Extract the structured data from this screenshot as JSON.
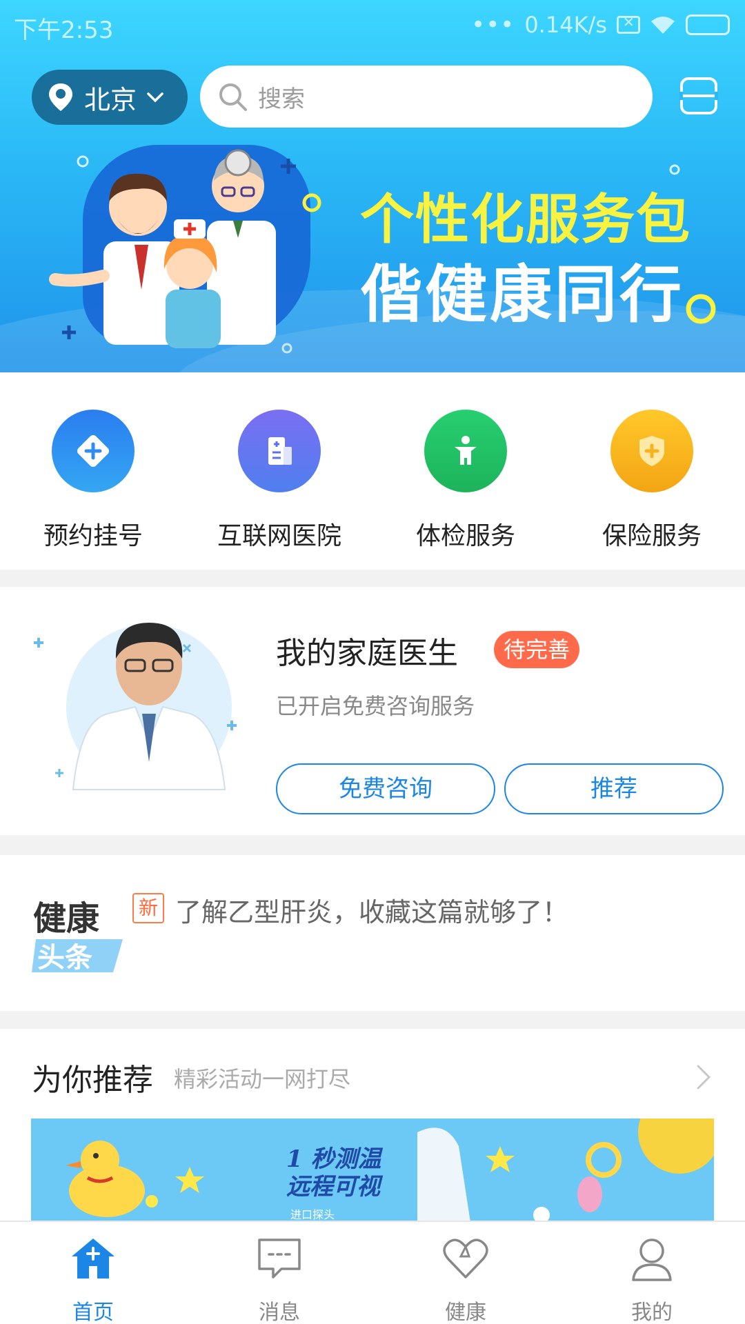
{
  "status_bar": {
    "time": "下午2:53",
    "dots": "•••",
    "speed": "0.14K/s"
  },
  "header": {
    "city": "北京",
    "search_placeholder": "搜索"
  },
  "banner": {
    "slogan_line1": "个性化服务包",
    "slogan_line2": "偕健康同行"
  },
  "quick_entries": [
    {
      "label": "预约挂号",
      "icon": "diamond-plus-icon",
      "color": "#2f8df0"
    },
    {
      "label": "互联网医院",
      "icon": "hospital-building-icon",
      "color": "#5d6ff0"
    },
    {
      "label": "体检服务",
      "icon": "body-figure-icon",
      "color": "#22c66a"
    },
    {
      "label": "保险服务",
      "icon": "shield-plus-icon",
      "color": "#f7b21f"
    }
  ],
  "family_doctor": {
    "title": "我的家庭医生",
    "badge": "待完善",
    "subtitle": "已开启免费咨询服务",
    "buttons": {
      "consult": "免费咨询",
      "recommend": "推荐"
    }
  },
  "headline": {
    "logo_line1": "健康",
    "logo_line2": "头条",
    "new_tag": "新",
    "text": "了解乙型肝炎，收藏这篇就够了！"
  },
  "recommend": {
    "title": "为你推荐",
    "subtitle": "精彩活动一网打尽",
    "banner_line1": "1 秒测温",
    "banner_line2": "远程可视",
    "banner_small": "进口探头"
  },
  "tabbar": [
    {
      "label": "首页",
      "icon": "home-icon",
      "active": true
    },
    {
      "label": "消息",
      "icon": "message-icon",
      "active": false
    },
    {
      "label": "健康",
      "icon": "heart-icon",
      "active": false
    },
    {
      "label": "我的",
      "icon": "person-icon",
      "active": false
    }
  ],
  "colors": {
    "primary": "#1b86e6",
    "badge": "#ff6a4a",
    "slogan_yellow": "#f8f241"
  }
}
